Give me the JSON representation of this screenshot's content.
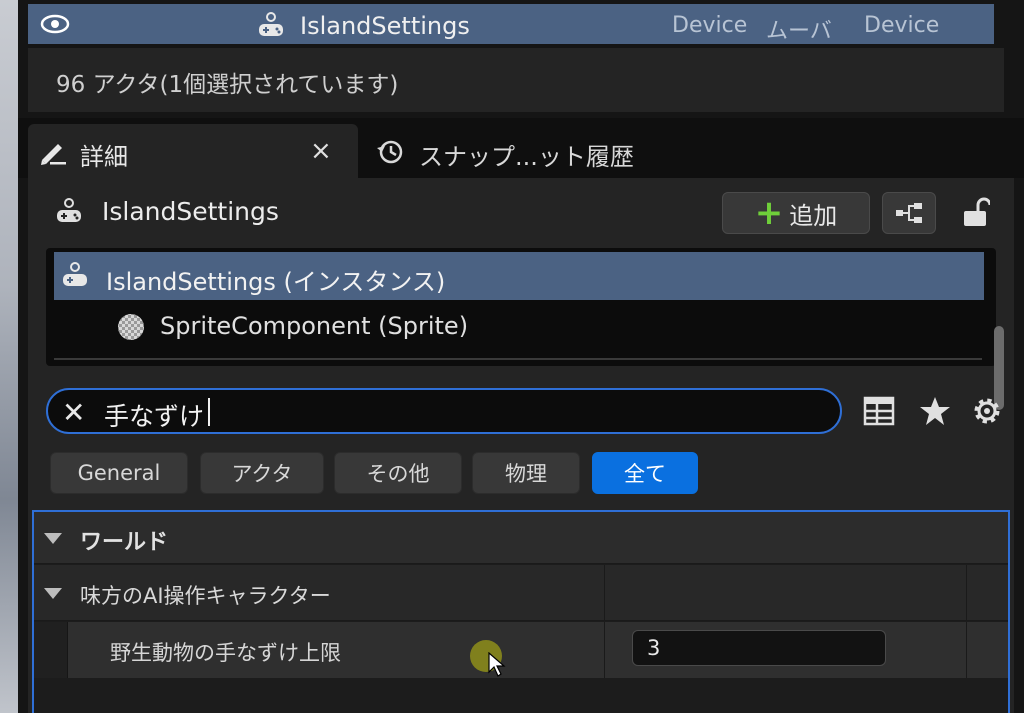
{
  "outliner": {
    "selected_row": {
      "name": "IslandSettings",
      "col1": "Device",
      "col2": "ムーバ",
      "col3": "Device"
    },
    "count_text": "96 アクタ(1個選択されています)"
  },
  "tabs": [
    {
      "label": "詳細",
      "icon": "pencil-icon",
      "active": true,
      "close": "×"
    },
    {
      "label": "スナップ...ット履歴",
      "icon": "history-icon",
      "active": false
    }
  ],
  "details": {
    "header_name": "IslandSettings",
    "add_label": "追加",
    "add_plus": "+",
    "components": [
      {
        "label": "IslandSettings (インスタンス)",
        "selected": true
      },
      {
        "label": "SpriteComponent (Sprite)",
        "selected": false
      }
    ],
    "search": {
      "clear": "✕",
      "value": "手なずけ"
    },
    "filters": [
      "General",
      "アクタ",
      "その他",
      "物理",
      "全て"
    ],
    "active_filter": "全て",
    "category": "ワールド",
    "subcategory": "味方のAI操作キャラクター",
    "property": {
      "label": "野生動物の手なずけ上限",
      "value": "3"
    }
  },
  "colors": {
    "selection": "#4b6283",
    "accent_blue": "#0a70e0",
    "focus_border": "#2f6fd6",
    "add_green": "#6fcf3a"
  }
}
